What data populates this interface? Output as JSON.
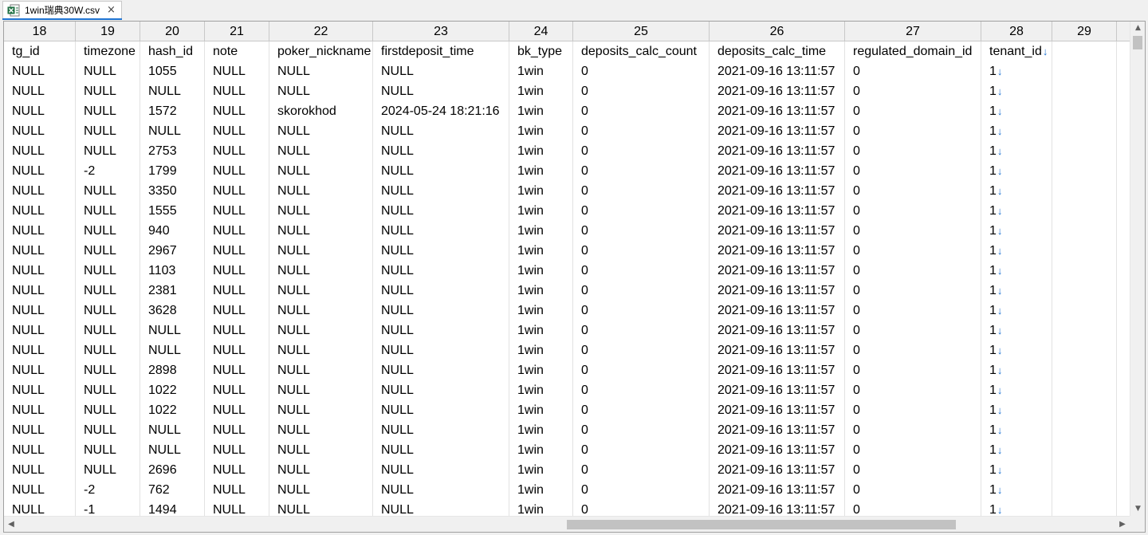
{
  "tab": {
    "title": "1win瑞典30W.csv",
    "close_glyph": "×",
    "icon": "excel-csv-icon"
  },
  "colors": {
    "accent": "#1e73d2",
    "excel_green": "#1d6f42"
  },
  "columns": [
    {
      "index": "18",
      "name": "tg_id"
    },
    {
      "index": "19",
      "name": "timezone"
    },
    {
      "index": "20",
      "name": "hash_id"
    },
    {
      "index": "21",
      "name": "note"
    },
    {
      "index": "22",
      "name": "poker_nickname"
    },
    {
      "index": "23",
      "name": "firstdeposit_time"
    },
    {
      "index": "24",
      "name": "bk_type"
    },
    {
      "index": "25",
      "name": "deposits_calc_count"
    },
    {
      "index": "26",
      "name": "deposits_calc_time"
    },
    {
      "index": "27",
      "name": "regulated_domain_id"
    },
    {
      "index": "28",
      "name": "tenant_id"
    },
    {
      "index": "29",
      "name": ""
    }
  ],
  "wrap_glyph": "↓",
  "rows": [
    [
      "NULL",
      "NULL",
      "1055",
      "NULL",
      "NULL",
      "NULL",
      "1win",
      "0",
      "2021-09-16 13:11:57",
      "0",
      "1"
    ],
    [
      "NULL",
      "NULL",
      "NULL",
      "NULL",
      "NULL",
      "NULL",
      "1win",
      "0",
      "2021-09-16 13:11:57",
      "0",
      "1"
    ],
    [
      "NULL",
      "NULL",
      "1572",
      "NULL",
      "skorokhod",
      "2024-05-24 18:21:16",
      "1win",
      "0",
      "2021-09-16 13:11:57",
      "0",
      "1"
    ],
    [
      "NULL",
      "NULL",
      "NULL",
      "NULL",
      "NULL",
      "NULL",
      "1win",
      "0",
      "2021-09-16 13:11:57",
      "0",
      "1"
    ],
    [
      "NULL",
      "NULL",
      "2753",
      "NULL",
      "NULL",
      "NULL",
      "1win",
      "0",
      "2021-09-16 13:11:57",
      "0",
      "1"
    ],
    [
      "NULL",
      "-2",
      "1799",
      "NULL",
      "NULL",
      "NULL",
      "1win",
      "0",
      "2021-09-16 13:11:57",
      "0",
      "1"
    ],
    [
      "NULL",
      "NULL",
      "3350",
      "NULL",
      "NULL",
      "NULL",
      "1win",
      "0",
      "2021-09-16 13:11:57",
      "0",
      "1"
    ],
    [
      "NULL",
      "NULL",
      "1555",
      "NULL",
      "NULL",
      "NULL",
      "1win",
      "0",
      "2021-09-16 13:11:57",
      "0",
      "1"
    ],
    [
      "NULL",
      "NULL",
      "940",
      "NULL",
      "NULL",
      "NULL",
      "1win",
      "0",
      "2021-09-16 13:11:57",
      "0",
      "1"
    ],
    [
      "NULL",
      "NULL",
      "2967",
      "NULL",
      "NULL",
      "NULL",
      "1win",
      "0",
      "2021-09-16 13:11:57",
      "0",
      "1"
    ],
    [
      "NULL",
      "NULL",
      "1103",
      "NULL",
      "NULL",
      "NULL",
      "1win",
      "0",
      "2021-09-16 13:11:57",
      "0",
      "1"
    ],
    [
      "NULL",
      "NULL",
      "2381",
      "NULL",
      "NULL",
      "NULL",
      "1win",
      "0",
      "2021-09-16 13:11:57",
      "0",
      "1"
    ],
    [
      "NULL",
      "NULL",
      "3628",
      "NULL",
      "NULL",
      "NULL",
      "1win",
      "0",
      "2021-09-16 13:11:57",
      "0",
      "1"
    ],
    [
      "NULL",
      "NULL",
      "NULL",
      "NULL",
      "NULL",
      "NULL",
      "1win",
      "0",
      "2021-09-16 13:11:57",
      "0",
      "1"
    ],
    [
      "NULL",
      "NULL",
      "NULL",
      "NULL",
      "NULL",
      "NULL",
      "1win",
      "0",
      "2021-09-16 13:11:57",
      "0",
      "1"
    ],
    [
      "NULL",
      "NULL",
      "2898",
      "NULL",
      "NULL",
      "NULL",
      "1win",
      "0",
      "2021-09-16 13:11:57",
      "0",
      "1"
    ],
    [
      "NULL",
      "NULL",
      "1022",
      "NULL",
      "NULL",
      "NULL",
      "1win",
      "0",
      "2021-09-16 13:11:57",
      "0",
      "1"
    ],
    [
      "NULL",
      "NULL",
      "1022",
      "NULL",
      "NULL",
      "NULL",
      "1win",
      "0",
      "2021-09-16 13:11:57",
      "0",
      "1"
    ],
    [
      "NULL",
      "NULL",
      "NULL",
      "NULL",
      "NULL",
      "NULL",
      "1win",
      "0",
      "2021-09-16 13:11:57",
      "0",
      "1"
    ],
    [
      "NULL",
      "NULL",
      "NULL",
      "NULL",
      "NULL",
      "NULL",
      "1win",
      "0",
      "2021-09-16 13:11:57",
      "0",
      "1"
    ],
    [
      "NULL",
      "NULL",
      "2696",
      "NULL",
      "NULL",
      "NULL",
      "1win",
      "0",
      "2021-09-16 13:11:57",
      "0",
      "1"
    ],
    [
      "NULL",
      "-2",
      "762",
      "NULL",
      "NULL",
      "NULL",
      "1win",
      "0",
      "2021-09-16 13:11:57",
      "0",
      "1"
    ],
    [
      "NULL",
      "-1",
      "1494",
      "NULL",
      "NULL",
      "NULL",
      "1win",
      "0",
      "2021-09-16 13:11:57",
      "0",
      "1"
    ]
  ],
  "scroll": {
    "up": "▲",
    "down": "▼",
    "left": "◀",
    "right": "▶"
  }
}
